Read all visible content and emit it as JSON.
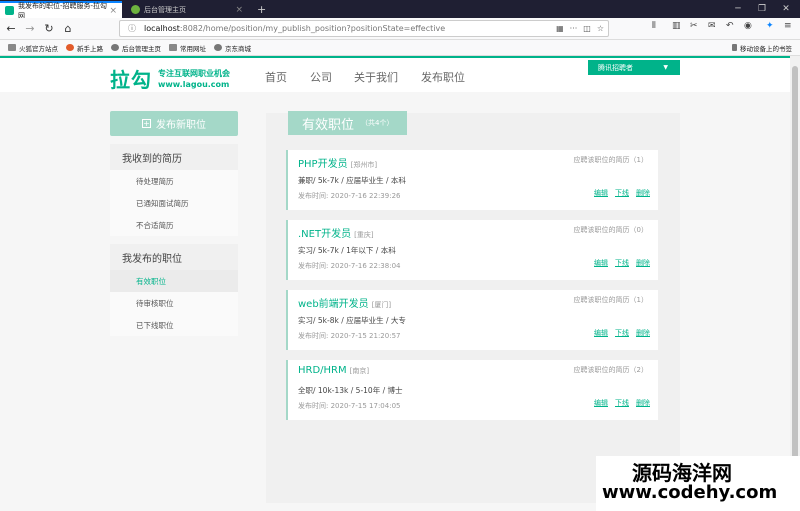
{
  "browser": {
    "tabs": [
      {
        "title": "我发布的职位-招聘服务-拉勾网",
        "active": true
      },
      {
        "title": "后台管理主页",
        "active": false
      }
    ],
    "new_tab": "+",
    "url_host": "localhost",
    "url_path": ":8082/home/position/my_publish_position?positionState=effective",
    "bookmarks": [
      "火狐官方站点",
      "新手上路",
      "后台管理主页",
      "常用网址",
      "京东商城"
    ],
    "mobile_bookmarks": "移动设备上的书签"
  },
  "site": {
    "logo_mark": "拉勾",
    "logo_tagline": "专注互联网职业机会",
    "logo_domain": "www.lagou.com",
    "nav": [
      "首页",
      "公司",
      "关于我们",
      "发布职位"
    ],
    "user_name": "腾讯招聘者"
  },
  "sidebar": {
    "publish_button": "发布新职位",
    "group1": {
      "title": "我收到的简历",
      "items": [
        "待处理简历",
        "已通知面试简历",
        "不合适简历"
      ]
    },
    "group2": {
      "title": "我发布的职位",
      "items": [
        "有效职位",
        "待审核职位",
        "已下线职位"
      ]
    }
  },
  "content": {
    "title": "有效职位",
    "count": "（共4个）",
    "positions": [
      {
        "name": "PHP开发员",
        "city": "[郑州市]",
        "info": "兼职/ 5k-7k / 应届毕业生 / 本科",
        "time": "发布时间:   2020-7-16 22:39:26",
        "resume": "应聘该职位的简历（1）"
      },
      {
        "name": ".NET开发员",
        "city": "[重庆]",
        "info": "实习/ 5k-7k / 1年以下 / 本科",
        "time": "发布时间:   2020-7-16 22:38:04",
        "resume": "应聘该职位的简历（0）"
      },
      {
        "name": "web前端开发员",
        "city": "[厦门]",
        "info": "实习/ 5k-8k / 应届毕业生 / 大专",
        "time": "发布时间:   2020-7-15 21:20:57",
        "resume": "应聘该职位的简历（1）"
      },
      {
        "name": "HRD/HRM",
        "city": "[南京]",
        "info": "全职/ 10k-13k / 5-10年 / 博士",
        "time": "发布时间:   2020-7-15 17:04:05",
        "resume": "应聘该职位的简历（2）"
      }
    ],
    "ops": [
      "编辑",
      "下线",
      "删除"
    ]
  },
  "watermark": {
    "line1": "源码海洋网",
    "line2": "www.codehy.com"
  },
  "colors": {
    "brand": "#00b38a",
    "brand_light": "#a4d8c8"
  }
}
